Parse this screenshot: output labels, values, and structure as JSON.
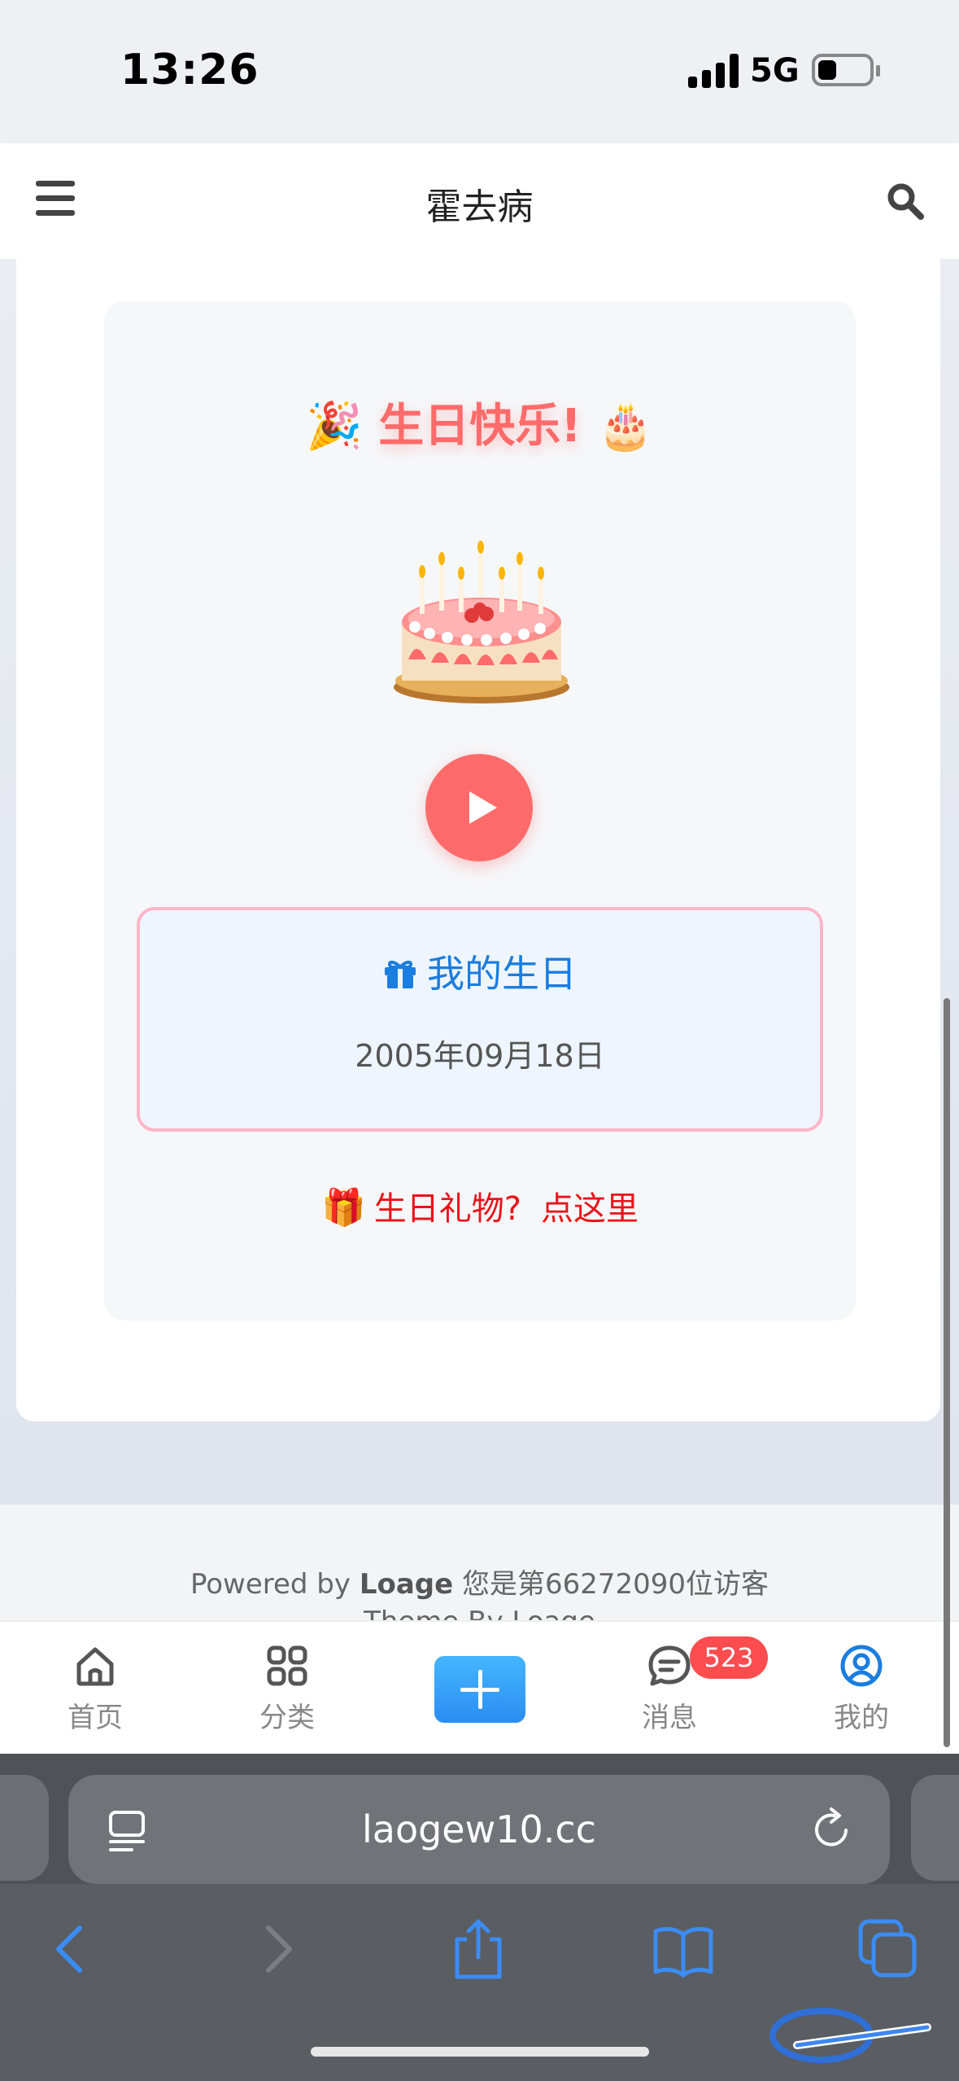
{
  "status_bar": {
    "time": "13:26",
    "network": "5G"
  },
  "header": {
    "title": "霍去病"
  },
  "birthday": {
    "title": "生日快乐!",
    "title_emoji_left": "🎉",
    "title_emoji_right": "🎂",
    "info_title": "我的生日",
    "date": "2005年09月18日",
    "gift_emoji": "🎁",
    "gift_text": "生日礼物?",
    "gift_click": "点这里"
  },
  "footer": {
    "powered_by": "Powered by ",
    "brand": "Loage",
    "visitor_text": " 您是第66272090位访客",
    "theme_text": "Theme By Loage"
  },
  "tabbar": {
    "items": [
      {
        "label": "首页",
        "icon": "home-icon"
      },
      {
        "label": "分类",
        "icon": "grid-icon"
      },
      {
        "label": "",
        "icon": "plus-icon"
      },
      {
        "label": "消息",
        "icon": "message-icon"
      },
      {
        "label": "我的",
        "icon": "user-icon"
      }
    ],
    "message_badge": "523"
  },
  "browser": {
    "url": "laogew10.cc"
  },
  "colors": {
    "accent_red": "#ff6b6b",
    "link_blue": "#1a7de0",
    "badge_red": "#ff4d4f",
    "add_blue": "#2a8df2"
  }
}
